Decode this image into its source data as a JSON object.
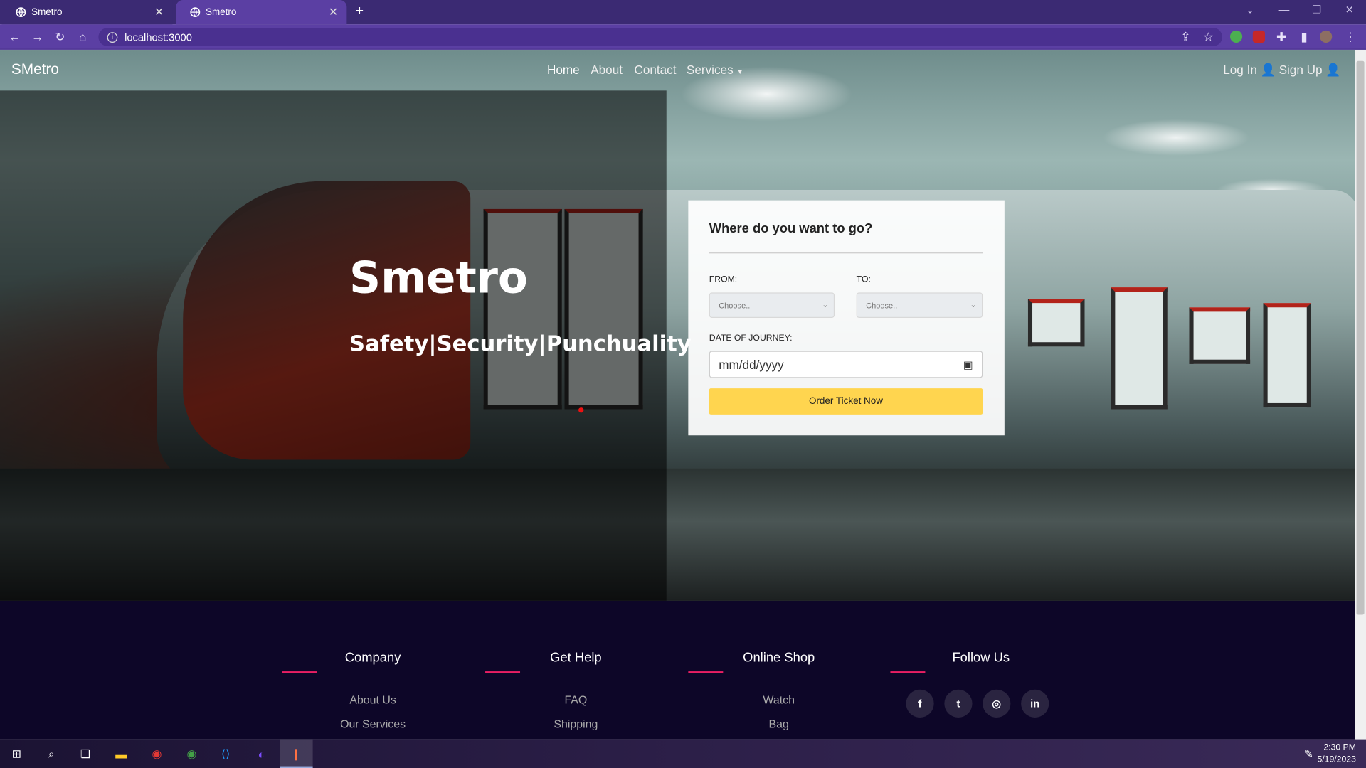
{
  "browser": {
    "tabs": [
      {
        "title": "Smetro"
      },
      {
        "title": "Smetro"
      }
    ],
    "url": "localhost:3000"
  },
  "nav": {
    "brand": "SMetro",
    "links": [
      "Home",
      "About",
      "Contact",
      "Services"
    ],
    "login": "Log In",
    "signup": "Sign Up"
  },
  "hero": {
    "title": "Smetro",
    "tagline": "Safety|Security|Punchuality"
  },
  "form": {
    "heading": "Where do you want to go?",
    "from_label": "FROM:",
    "to_label": "TO:",
    "from_value": "Choose..",
    "to_value": "Choose..",
    "date_label": "DATE OF JOURNEY:",
    "date_placeholder": "mm/dd/yyyy",
    "button": "Order Ticket Now"
  },
  "footer": {
    "columns": [
      {
        "heading": "Company",
        "links": [
          "About Us",
          "Our Services"
        ]
      },
      {
        "heading": "Get Help",
        "links": [
          "FAQ",
          "Shipping"
        ]
      },
      {
        "heading": "Online Shop",
        "links": [
          "Watch",
          "Bag"
        ]
      },
      {
        "heading": "Follow Us",
        "social": [
          "facebook-icon",
          "twitter-icon",
          "instagram-icon",
          "linkedin-icon"
        ]
      }
    ]
  },
  "taskbar": {
    "time": "2:30 PM",
    "date": "5/19/2023"
  },
  "colors": {
    "tab_bar": "#3b2a73",
    "toolbar": "#5b3fa3",
    "footer": "#0d0628",
    "button": "#ffd54f",
    "accent_line": "#e91e63"
  }
}
